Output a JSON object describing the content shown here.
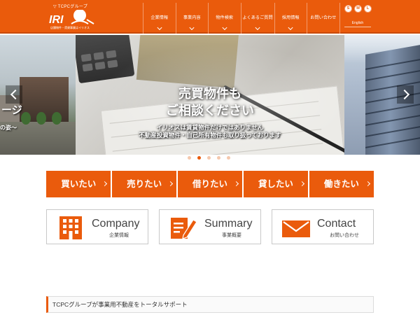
{
  "header": {
    "group_label": "TCPCグループ",
    "logo_text": "IRI",
    "logo_tagline": "店舗物件・賃貸事業はイリオス",
    "nav": [
      {
        "label": "企業情報"
      },
      {
        "label": "事業内容"
      },
      {
        "label": "物件検索"
      },
      {
        "label": "よくあるご質問"
      },
      {
        "label": "採用情報"
      },
      {
        "label": "お問い合わせ"
      }
    ],
    "font_sizes": [
      "S",
      "M",
      "L"
    ],
    "language_link": "English"
  },
  "hero": {
    "left_title": "ージ",
    "left_sub": "の姿～",
    "title_line1": "売買物件も",
    "title_line2": "ご相談ください",
    "sub_line1": "イリオスは賃貸物件だけではありません",
    "sub_line2": "不動産投資物件・自己所有物件も取り扱っております",
    "slide_count": 5,
    "active_slide": 2
  },
  "categories": [
    {
      "label": "買いたい"
    },
    {
      "label": "売りたい"
    },
    {
      "label": "借りたい"
    },
    {
      "label": "貸したい"
    },
    {
      "label": "働きたい"
    }
  ],
  "boxes": [
    {
      "title": "Company",
      "subtitle": "企業情報",
      "icon": "building-icon"
    },
    {
      "title": "Summary",
      "subtitle": "事業概要",
      "icon": "document-pen-icon"
    },
    {
      "title": "Contact",
      "subtitle": "お問い合わせ",
      "icon": "envelope-icon"
    }
  ],
  "headline": "TCPCグループが事業用不動産をトータルサポート",
  "colors": {
    "brand_orange": "#ea5b0c",
    "dot_inactive": "#f5c8ad"
  }
}
